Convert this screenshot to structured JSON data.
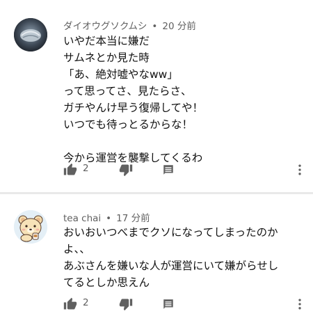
{
  "comments": [
    {
      "author": "ダイオウグソクムシ",
      "time": "20 分前",
      "lines": [
        "いやだ本当に嫌だ",
        "サムネとか見た時",
        "「あ、絶対嘘やなww」",
        "って思ってさ、見たらさ、",
        "ガチやんけ早う復帰してや！",
        "いつでも待っとるからな！",
        "",
        "今から運営を襲撃してくるわ"
      ],
      "likes": "2",
      "avatar_icon": "isopod-avatar-icon"
    },
    {
      "author": "tea chai",
      "time": "17 分前",
      "lines": [
        "おいおいつべまでクソになってしまったのか",
        "よ、、",
        "あぶさんを嫌いな人が運営にいて嫌がらせし",
        "てるとしか思えん"
      ],
      "likes": "2",
      "avatar_icon": "bear-avatar-icon"
    }
  ],
  "separator": "•",
  "colors": {
    "meta": "#606060",
    "icon": "#606060",
    "text": "#111111",
    "divider": "#e9e9e9"
  }
}
